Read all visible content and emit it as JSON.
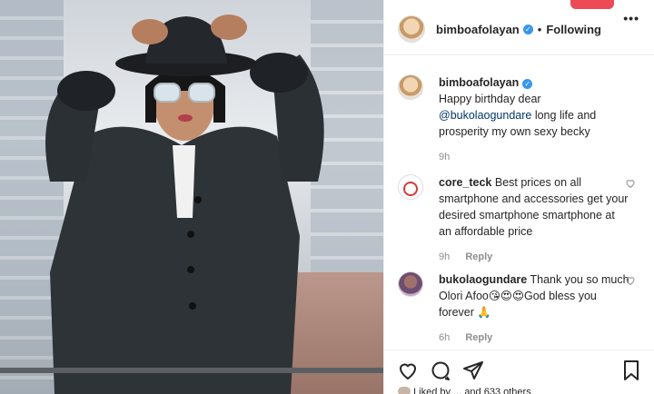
{
  "post": {
    "author": "bimboafolayan",
    "follow_state": "Following",
    "more_label": "•••"
  },
  "caption": {
    "user": "bimboafolayan",
    "text_pre": "Happy birthday dear",
    "mention": "@bukolaogundare",
    "text_post": " long life and prosperity my own sexy becky",
    "time": "9h"
  },
  "comments": [
    {
      "user": "core_teck",
      "text": "Best prices on all smartphone and accessories get your desired smartphone smartphone at an affordable price",
      "time": "9h",
      "reply": "Reply"
    },
    {
      "user": "bukolaogundare",
      "text": "Thank you so much Olori Afoo😘😍😍God bless you forever 🙏",
      "time": "6h",
      "reply": "Reply"
    }
  ],
  "likes_line": "Liked by ... and 633 others",
  "icons": [
    "heart-icon",
    "comment-icon",
    "share-icon",
    "save-icon",
    "verified-icon",
    "more-icon"
  ],
  "colors": {
    "verified": "#3897f0",
    "accent_red": "#ed4956",
    "muted": "#8e8e8e"
  }
}
